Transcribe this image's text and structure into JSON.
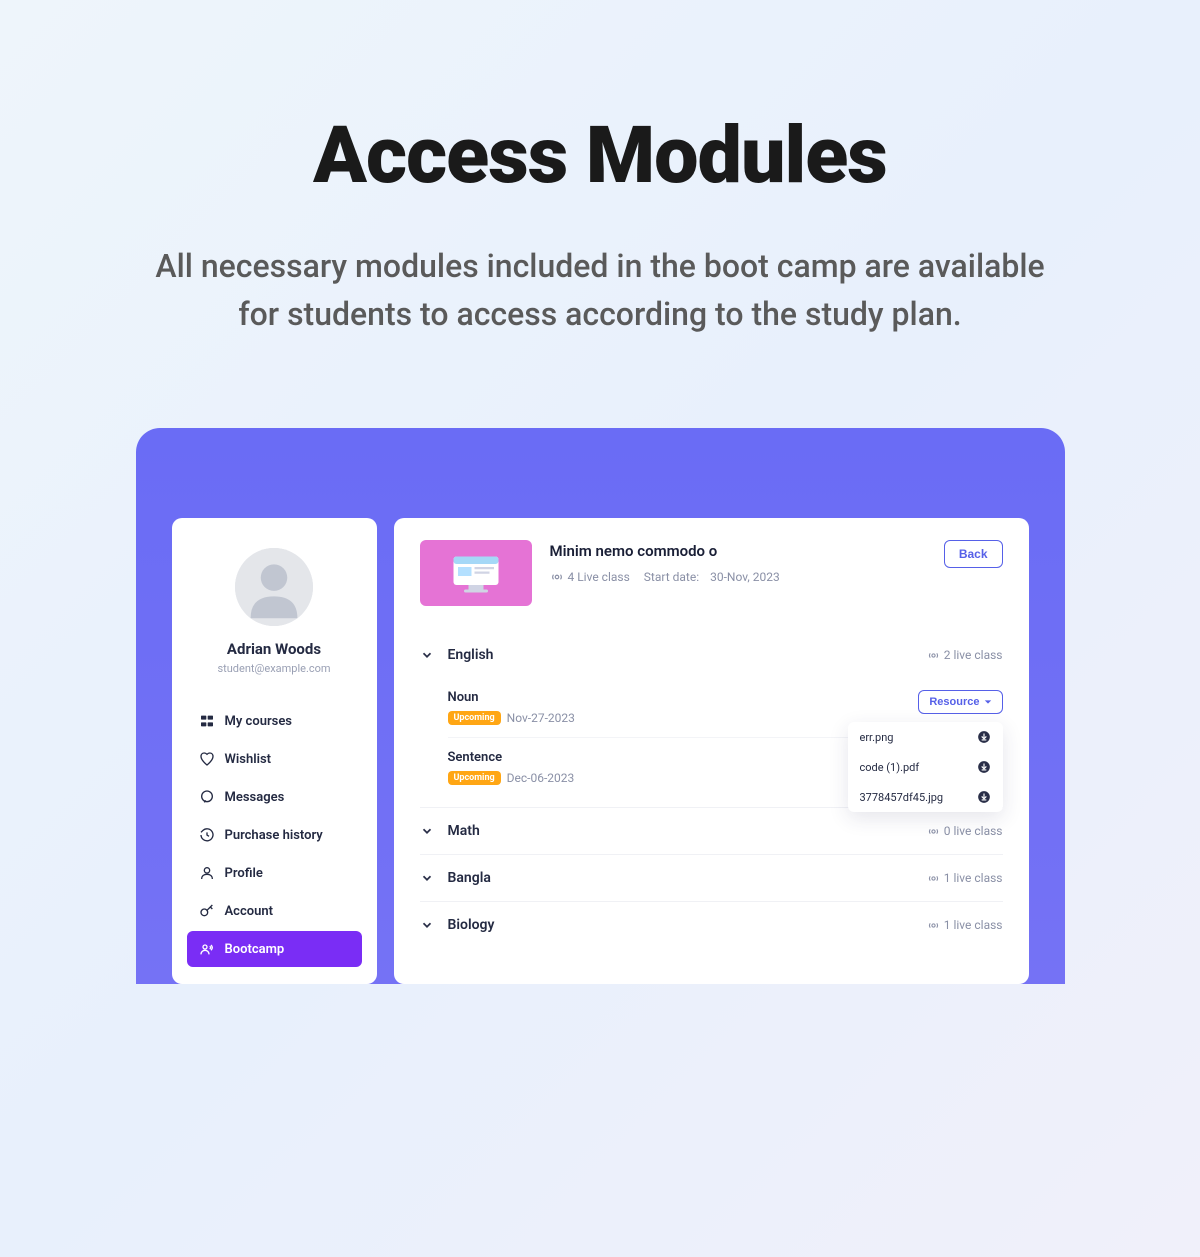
{
  "hero": {
    "title": "Access Modules",
    "subtitle": "All necessary modules included in the boot camp are available for students to access according to the study plan."
  },
  "sidebar": {
    "user": {
      "name": "Adrian Woods",
      "email": "student@example.com"
    },
    "items": [
      {
        "label": "My courses",
        "icon": "courses"
      },
      {
        "label": "Wishlist",
        "icon": "heart"
      },
      {
        "label": "Messages",
        "icon": "chat"
      },
      {
        "label": "Purchase history",
        "icon": "history"
      },
      {
        "label": "Profile",
        "icon": "person"
      },
      {
        "label": "Account",
        "icon": "key"
      },
      {
        "label": "Bootcamp",
        "icon": "bootcamp",
        "active": true
      }
    ]
  },
  "course": {
    "title": "Minim nemo commodo o",
    "live_count": "4 Live class",
    "start_date_label": "Start date:",
    "start_date": "30-Nov, 2023",
    "back_label": "Back"
  },
  "modules": [
    {
      "name": "English",
      "count": "2 live class",
      "expanded": true,
      "topics": [
        {
          "title": "Noun",
          "badge": "Upcoming",
          "date": "Nov-27-2023",
          "has_resource": true
        },
        {
          "title": "Sentence",
          "badge": "Upcoming",
          "date": "Dec-06-2023"
        }
      ]
    },
    {
      "name": "Math",
      "count": "0 live class"
    },
    {
      "name": "Bangla",
      "count": "1 live class"
    },
    {
      "name": "Biology",
      "count": "1 live class"
    }
  ],
  "resource_label": "Resource",
  "resource_files": [
    {
      "name": "err.png"
    },
    {
      "name": "code (1).pdf"
    },
    {
      "name": "3778457df45.jpg"
    }
  ]
}
